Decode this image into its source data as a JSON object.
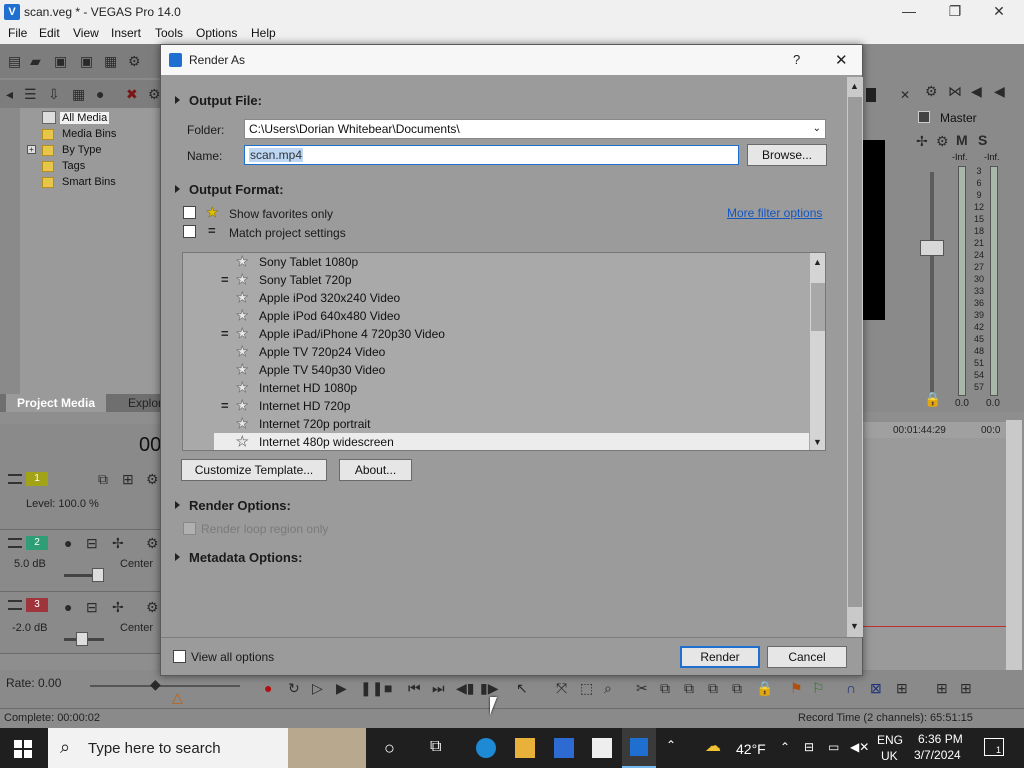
{
  "window": {
    "title": "scan.veg * - VEGAS Pro 14.0",
    "minimize": "—",
    "restore": "❐",
    "close": "✕"
  },
  "menu": [
    "File",
    "Edit",
    "View",
    "Insert",
    "Tools",
    "Options",
    "Help"
  ],
  "media_tree": {
    "items": [
      "All Media",
      "Media Bins",
      "By Type",
      "Tags",
      "Smart Bins"
    ],
    "expand": "+"
  },
  "panel_tabs": [
    "Project Media",
    "Explor"
  ],
  "dialog": {
    "title": "Render As",
    "help": "?",
    "close": "✕",
    "output_file": {
      "heading": "Output File:",
      "folder_label": "Folder:",
      "folder_value": "C:\\Users\\Dorian Whitebear\\Documents\\",
      "name_label": "Name:",
      "name_value": "scan.mp4",
      "browse": "Browse..."
    },
    "output_format": {
      "heading": "Output Format:",
      "show_favorites": "Show favorites only",
      "match_project": "Match project settings",
      "more_filter": "More filter options",
      "templates": [
        {
          "name": "Sony Tablet 1080p",
          "match": false
        },
        {
          "name": "Sony Tablet 720p",
          "match": true
        },
        {
          "name": "Apple iPod 320x240 Video",
          "match": false
        },
        {
          "name": "Apple iPod 640x480 Video",
          "match": false
        },
        {
          "name": "Apple iPad/iPhone 4 720p30 Video",
          "match": true
        },
        {
          "name": "Apple TV 720p24 Video",
          "match": false
        },
        {
          "name": "Apple TV 540p30 Video",
          "match": false
        },
        {
          "name": "Internet HD 1080p",
          "match": false
        },
        {
          "name": "Internet HD 720p",
          "match": true
        },
        {
          "name": "Internet 720p portrait",
          "match": false
        },
        {
          "name": "Internet 480p widescreen",
          "match": false,
          "selected": true
        }
      ],
      "customize": "Customize Template...",
      "about": "About..."
    },
    "render_options": {
      "heading": "Render Options:",
      "loop_region": "Render loop region only"
    },
    "metadata_options": {
      "heading": "Metadata Options:"
    },
    "footer": {
      "view_all": "View all options",
      "render": "Render",
      "cancel": "Cancel"
    }
  },
  "master": {
    "label": "Master",
    "inf_left": "-Inf.",
    "inf_right": "-Inf.",
    "scale": [
      "3",
      "6",
      "9",
      "12",
      "15",
      "18",
      "21",
      "24",
      "27",
      "30",
      "33",
      "36",
      "39",
      "42",
      "45",
      "48",
      "51",
      "54",
      "57"
    ],
    "value_left": "0.0",
    "value_right": "0.0"
  },
  "timeline": {
    "time_partial": "00",
    "ruler_time_1": "00:01:44:29",
    "ruler_time_2": "00:0",
    "tracks": [
      {
        "num": "1",
        "info": "Level: 100.0 %",
        "color": "#a3a317"
      },
      {
        "num": "2",
        "info": "5.0 dB",
        "pan": "Center",
        "color": "#2f9e76"
      },
      {
        "num": "3",
        "info": "-2.0 dB",
        "pan": "Center",
        "color": "#a0343d"
      }
    ]
  },
  "transport": {
    "rate": "Rate: 0.00"
  },
  "status": {
    "complete": "Complete: 00:00:02",
    "record_time": "Record Time (2 channels): 65:51:15"
  },
  "taskbar": {
    "search_placeholder": "Type here to search",
    "weather": "42°F",
    "lang_1": "ENG",
    "lang_2": "UK",
    "time": "6:36 PM",
    "date": "3/7/2024",
    "notif_count": "1"
  },
  "colors": {
    "accent": "#1e6fd0",
    "link": "#1456c2",
    "dialog_bg": "#9b9b9b"
  }
}
